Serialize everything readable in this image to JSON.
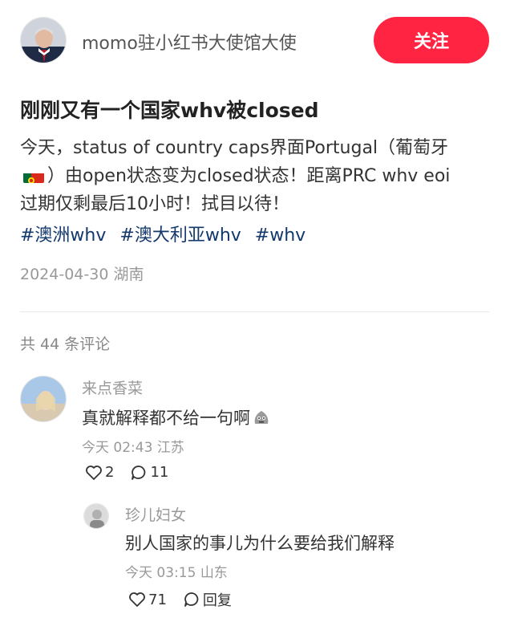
{
  "author": {
    "name": "momo驻小红书大使馆大使",
    "follow_label": "关注"
  },
  "post": {
    "title": "刚刚又有一个国家whv被closed",
    "line1": "今天，status of country caps界面Portugal（葡萄牙",
    "line2": "）由open状态变为closed状态！距离PRC whv eoi",
    "line3": "过期仅剩最后10小时！拭目以待！",
    "flag_icon": "portugal-flag-icon",
    "tags": [
      "#澳洲whv",
      "#澳大利亚whv",
      "#whv"
    ],
    "date": "2024-04-30",
    "location": "湖南"
  },
  "comments_header": "共 44 条评论",
  "comments": [
    {
      "user": "来点香菜",
      "text": "真就解释都不给一句啊",
      "emoji_icon": "annoyed-face-emoji",
      "time": "今天 02:43",
      "location": "江苏",
      "likes": "2",
      "replies": "11",
      "reply": {
        "user": "珍儿妇女",
        "text": "别人国家的事儿为什么要给我们解释",
        "time": "今天 03:15",
        "location": "山东",
        "likes": "71",
        "reply_label": "回复"
      }
    }
  ],
  "colors": {
    "accent": "#ff2442",
    "tag": "#13386c",
    "muted": "#999999"
  }
}
